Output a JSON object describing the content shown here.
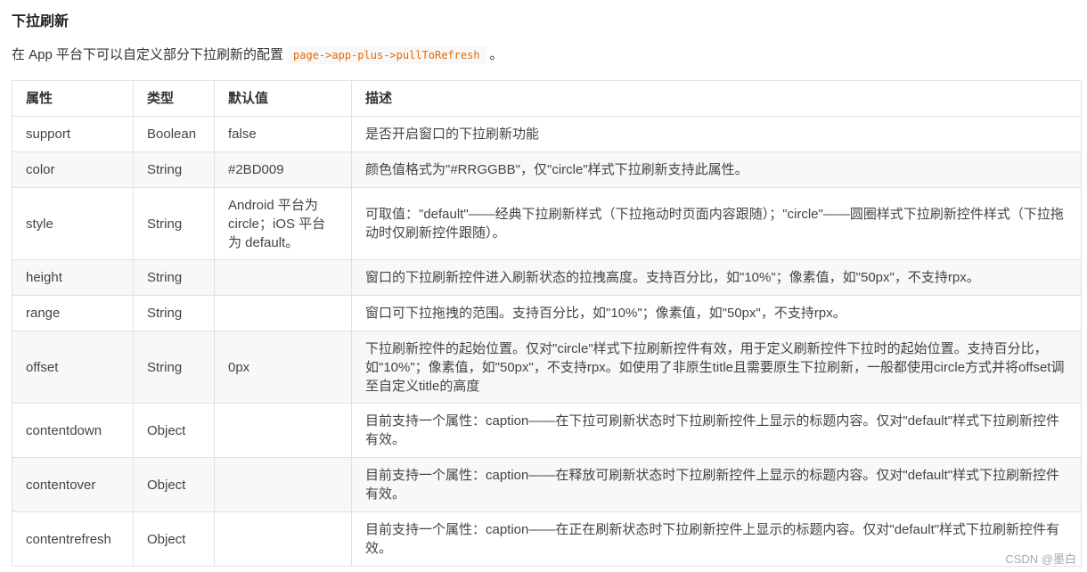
{
  "heading": "下拉刷新",
  "intro": {
    "before": "在 App 平台下可以自定义部分下拉刷新的配置",
    "code": "page->app-plus->pullToRefresh",
    "after": "。"
  },
  "table": {
    "headers": [
      "属性",
      "类型",
      "默认值",
      "描述"
    ],
    "rows": [
      [
        "support",
        "Boolean",
        "false",
        "是否开启窗口的下拉刷新功能"
      ],
      [
        "color",
        "String",
        "#2BD009",
        "颜色值格式为\"#RRGGBB\"，仅\"circle\"样式下拉刷新支持此属性。"
      ],
      [
        "style",
        "String",
        "Android 平台为 circle；iOS 平台为 default。",
        "可取值：\"default\"——经典下拉刷新样式（下拉拖动时页面内容跟随）；\"circle\"——圆圈样式下拉刷新控件样式（下拉拖动时仅刷新控件跟随）。"
      ],
      [
        "height",
        "String",
        "",
        "窗口的下拉刷新控件进入刷新状态的拉拽高度。支持百分比，如\"10%\"；像素值，如\"50px\"，不支持rpx。"
      ],
      [
        "range",
        "String",
        "",
        "窗口可下拉拖拽的范围。支持百分比，如\"10%\"；像素值，如\"50px\"，不支持rpx。"
      ],
      [
        "offset",
        "String",
        "0px",
        "下拉刷新控件的起始位置。仅对\"circle\"样式下拉刷新控件有效，用于定义刷新控件下拉时的起始位置。支持百分比，如\"10%\"；像素值，如\"50px\"，不支持rpx。如使用了非原生title且需要原生下拉刷新，一般都使用circle方式并将offset调至自定义title的高度"
      ],
      [
        "contentdown",
        "Object",
        "",
        "目前支持一个属性：caption——在下拉可刷新状态时下拉刷新控件上显示的标题内容。仅对\"default\"样式下拉刷新控件有效。"
      ],
      [
        "contentover",
        "Object",
        "",
        "目前支持一个属性：caption——在释放可刷新状态时下拉刷新控件上显示的标题内容。仅对\"default\"样式下拉刷新控件有效。"
      ],
      [
        "contentrefresh",
        "Object",
        "",
        "目前支持一个属性：caption——在正在刷新状态时下拉刷新控件上显示的标题内容。仅对\"default\"样式下拉刷新控件有效。"
      ]
    ]
  },
  "watermark": "CSDN @墨白"
}
